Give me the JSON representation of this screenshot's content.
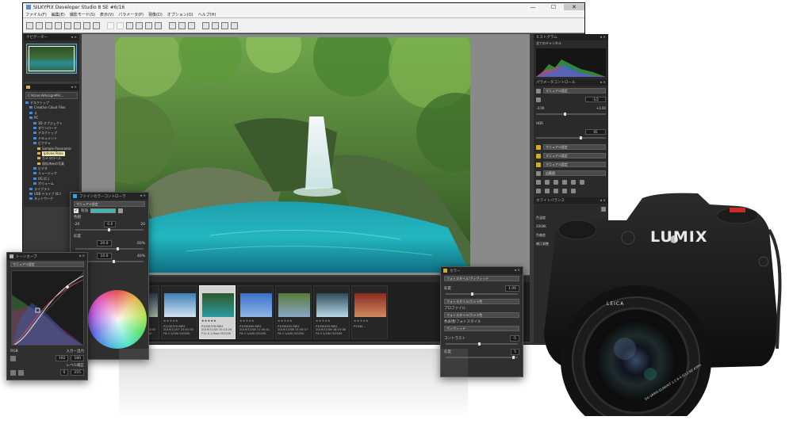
{
  "window": {
    "title": "SILKYPIX Developer Studio 8 SE  #6/16",
    "controls": [
      "—",
      "☐",
      "✕"
    ]
  },
  "menu": [
    "ファイル(F)",
    "編集(E)",
    "撮影モード(S)",
    "表示(V)",
    "パラメータ(P)",
    "現像(D)",
    "オプション(O)",
    "ヘルプ(H)"
  ],
  "navigator": {
    "title": "ナビゲーター"
  },
  "folders": {
    "path": "C:¥Users¥Assign¥Pic...",
    "tree": [
      {
        "label": "デスクトップ",
        "indent": 0,
        "type": "blue"
      },
      {
        "label": "Creative Cloud Files",
        "indent": 1,
        "type": "blue"
      },
      {
        "label": "え",
        "indent": 1,
        "type": "blue"
      },
      {
        "label": "PC",
        "indent": 1,
        "type": "blue"
      },
      {
        "label": "3D オブジェクト",
        "indent": 2,
        "type": "blue"
      },
      {
        "label": "ダウンロード",
        "indent": 2,
        "type": "blue"
      },
      {
        "label": "デスクトップ",
        "indent": 2,
        "type": "blue"
      },
      {
        "label": "ドキュメント",
        "indent": 2,
        "type": "blue"
      },
      {
        "label": "ピクチャ",
        "indent": 2,
        "type": "blue"
      },
      {
        "label": "Sample Panoramic",
        "indent": 3,
        "type": "folder"
      },
      {
        "label": "Iphone Pano",
        "indent": 3,
        "type": "folder",
        "selected": true
      },
      {
        "label": "カメラロール",
        "indent": 3,
        "type": "folder"
      },
      {
        "label": "保存済みの写真",
        "indent": 3,
        "type": "folder"
      },
      {
        "label": "ビデオ",
        "indent": 2,
        "type": "blue"
      },
      {
        "label": "ミュージック",
        "indent": 2,
        "type": "blue"
      },
      {
        "label": "OS (C:)",
        "indent": 2,
        "type": "blue"
      },
      {
        "label": "ボリューム",
        "indent": 2,
        "type": "blue"
      },
      {
        "label": "ライブラリ",
        "indent": 1,
        "type": "blue"
      },
      {
        "label": "USB ドライブ (E:)",
        "indent": 1,
        "type": "blue"
      },
      {
        "label": "ネットワーク",
        "indent": 1,
        "type": "blue"
      }
    ]
  },
  "filmstrip": {
    "header": "表示数: 16",
    "thumbs": [
      {
        "caption": "P1030748.RW2\n2019/01/18 07:40:22\nF22.0 1/8sec ISO200",
        "colors": [
          "#1b2f5a",
          "#95a8c8"
        ]
      },
      {
        "caption": "P1140698.RW2\n2019/11/07 20:14:55\nF7.1 1/200 ISO200",
        "colors": [
          "#2a3a4a",
          "#a0b0a0"
        ]
      },
      {
        "caption": "P1230370.RW2\n2019/11/07 23:01:55\nF6.3 1/200 ISO200",
        "colors": [
          "#3c7fb8",
          "#d2e4f0"
        ]
      },
      {
        "caption": "P1030376.RW2\n2019/11/08 10:13:26\nF11.0 1/3sec ISO200",
        "colors": [
          "#2f5a2a",
          "#2b9aa0"
        ],
        "selected": true
      },
      {
        "caption": "P1030460.RW2\n2019/11/08 11:35:41\nF6.3 1/400 ISO200",
        "colors": [
          "#3b70c8",
          "#8fb6e6"
        ]
      },
      {
        "caption": "P1030452.RW2\n2019/11/08 13:33:37\nF6.3 1/400 ISO200",
        "colors": [
          "#5a7a3a",
          "#88a8c8"
        ]
      },
      {
        "caption": "P1030425.RW2\n2019/11/08 18:23:36\nF4.0 1/160 ISO200",
        "colors": [
          "#2c4c5a",
          "#b8d8e8"
        ]
      },
      {
        "caption": "P1030...",
        "colors": [
          "#8a2b20",
          "#d08a60"
        ]
      }
    ]
  },
  "right_panel": {
    "histogram_title": "ヒストグラム",
    "histogram_mode": "全てのチャンネル",
    "param_title": "パラメータコントロール",
    "preset": "マニュアル設定",
    "exposure_value": "-1/2",
    "exposure_range": [
      "-3.00",
      "+3.00"
    ],
    "hdr_label": "HDR",
    "hdr_value": "65",
    "rows": [
      "マニュアル設定",
      "マニュアル設定",
      "マニュアル設定",
      "広範囲"
    ],
    "wb_title": "ホワイトバランス",
    "wb_rows": [
      {
        "label": "色温度",
        "value": "4000"
      },
      {
        "label": "色偏差",
        "value": "0"
      },
      {
        "label": "補正調整",
        "value": "0"
      }
    ],
    "wb_range": [
      "2000K",
      "8000K"
    ]
  },
  "fine_color": {
    "title": "ファインカラーコントローラ",
    "preset": "マニュアル設定",
    "enable_label": "有効",
    "hue_label": "色相",
    "hue_value": "0.0",
    "hue_range": [
      "-20",
      "20"
    ],
    "sat_label": "彩度",
    "sat_value": "20.0",
    "sat_max": "60%",
    "bright_value": "10.0",
    "bright_max": "40%"
  },
  "tone_curve": {
    "title": "トーンカーブ",
    "preset": "マニュアル設定",
    "channel": "RGB",
    "io_label": "入力・出力",
    "input": "192",
    "output": "180",
    "level_label": "レベル補正",
    "level_min": "0",
    "level_max": "255"
  },
  "color_panel": {
    "title": "カラー",
    "preset": "フォトスタイル:ヴィヴィッド",
    "saturation_label": "彩度",
    "saturation_value": "1.00",
    "color_mode": "フォトスタイル/カメラ色",
    "profile_label": "プロファイル",
    "profile_value": "フォトスタイル/カメラ色",
    "style_label": "色表現/フォトスタイル",
    "style_value": "ヴィヴィッド",
    "contrast_label": "コントラスト",
    "contrast_value": "-5",
    "sat2_label": "彩度",
    "sat2_value": "5"
  },
  "camera": {
    "brand": "LUMIX",
    "lens_brand": "LEICA",
    "lens_text": "DG VARIO-ELMARIT 1:2.8-4.0/12-60 ASPH."
  },
  "colors": {
    "accent": "#3fb6b0",
    "selection": "#f2e7b0",
    "panel": "#2d2d2d"
  }
}
